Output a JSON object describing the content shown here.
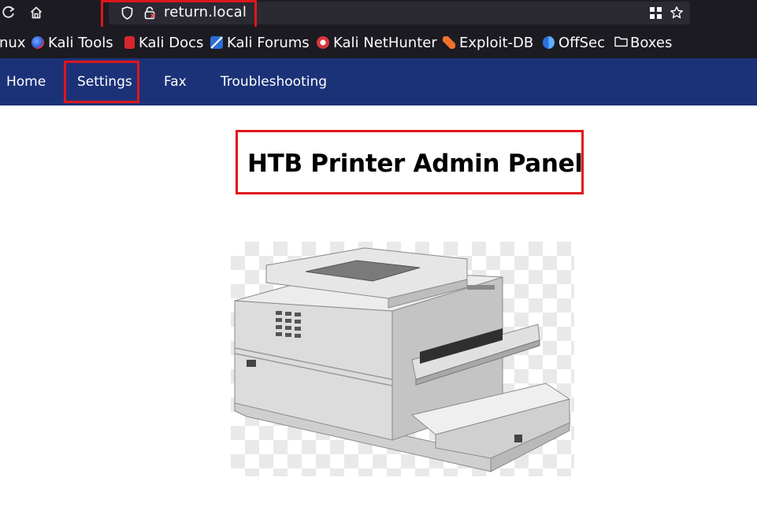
{
  "browser": {
    "url": "return.local",
    "bookmarks": [
      {
        "label": "nux",
        "icon": "kali-linux-icon"
      },
      {
        "label": "Kali Tools",
        "icon": "kali-tools-icon"
      },
      {
        "label": "Kali Docs",
        "icon": "kali-docs-icon"
      },
      {
        "label": "Kali Forums",
        "icon": "kali-forums-icon"
      },
      {
        "label": "Kali NetHunter",
        "icon": "kali-nethunter-icon"
      },
      {
        "label": "Exploit-DB",
        "icon": "exploit-db-icon"
      },
      {
        "label": "OffSec",
        "icon": "offsec-icon"
      },
      {
        "label": "Boxes",
        "icon": "folder-icon"
      }
    ]
  },
  "nav": {
    "items": [
      {
        "label": "Home"
      },
      {
        "label": "Settings"
      },
      {
        "label": "Fax"
      },
      {
        "label": "Troubleshooting"
      }
    ]
  },
  "main": {
    "title": "HTB Printer Admin Panel",
    "image_alt": "printer illustration"
  },
  "colors": {
    "navbar": "#1c3278",
    "highlight": "#e0151c",
    "chrome": "#1c1b22"
  }
}
